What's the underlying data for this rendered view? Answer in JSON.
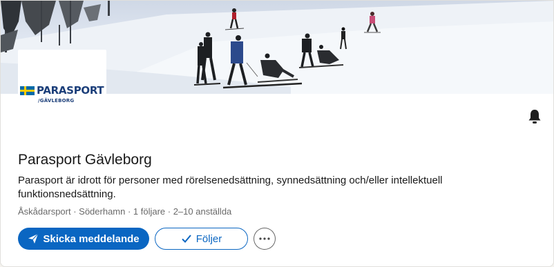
{
  "company": {
    "name": "Parasport Gävleborg",
    "description": "Parasport är idrott för personer med rörelsenedsättning, synnedsättning och/eller intellektuell funktionsnedsättning.",
    "meta": "Åskådarsport · Söderhamn · 1 följare · 2–10 anställda"
  },
  "logo": {
    "word": "PARASPORT",
    "sub": "/GÄVLEBORG"
  },
  "actions": {
    "message_label": "Skicka meddelande",
    "follow_label": "Följer",
    "more_icon": "more-horizontal-icon",
    "bell_icon": "bell-icon"
  },
  "colors": {
    "accent": "#0a66c2",
    "brand_navy": "#1c3f7a"
  }
}
